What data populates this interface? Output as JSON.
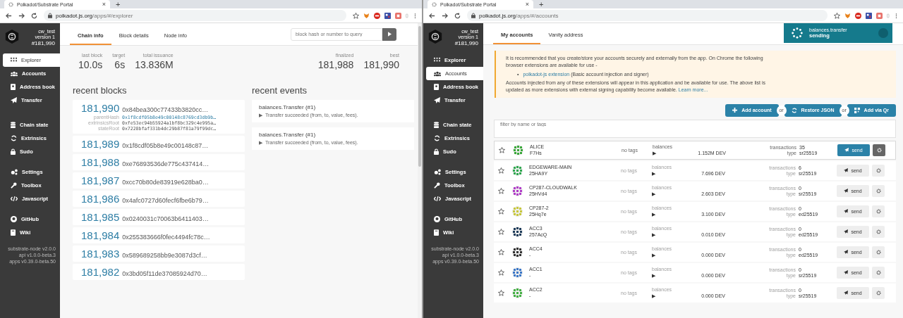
{
  "windows": [
    {
      "tab_title": "Polkadot/Substrate Portal",
      "tab_close": "×",
      "new_tab": "+",
      "url_host": "polkadot.js.org",
      "url_path": "/apps/#/explorer",
      "sidebar": {
        "chain": "cw_test",
        "version": "version 1",
        "block": "#181,990",
        "groups": [
          {
            "items": [
              {
                "label": "Explorer",
                "selected": true
              },
              {
                "label": "Accounts",
                "selected": false
              },
              {
                "label": "Address book",
                "selected": false
              },
              {
                "label": "Transfer",
                "selected": false
              }
            ]
          },
          {
            "items": [
              {
                "label": "Chain state",
                "selected": false
              },
              {
                "label": "Extrinsics",
                "selected": false
              },
              {
                "label": "Sudo",
                "selected": false
              }
            ]
          },
          {
            "items": [
              {
                "label": "Settings",
                "selected": false
              },
              {
                "label": "Toolbox",
                "selected": false
              },
              {
                "label": "Javascript",
                "selected": false
              }
            ]
          },
          {
            "items": [
              {
                "label": "GitHub",
                "selected": false
              },
              {
                "label": "Wiki",
                "selected": false
              }
            ]
          }
        ],
        "versions": [
          "substrate-node v2.0.0",
          "api v1.0.0-beta.3",
          "apps v0.39.0-beta.50"
        ]
      },
      "page": {
        "kind": "explorer",
        "tabs": [
          {
            "label": "Chain info",
            "selected": true
          },
          {
            "label": "Block details",
            "selected": false
          },
          {
            "label": "Node info",
            "selected": false
          }
        ],
        "search": {
          "placeholder": "block hash or number to query"
        },
        "summary_left": [
          {
            "label": "last block",
            "value": "10.0s"
          },
          {
            "label": "target",
            "value": "6s"
          },
          {
            "label": "total issuance",
            "value": "13.836M"
          }
        ],
        "summary_right": [
          {
            "label": "finalized",
            "value": "181,988"
          },
          {
            "label": "best",
            "value": "181,990"
          }
        ],
        "recent_blocks": {
          "title": "recent blocks",
          "blocks": [
            {
              "number": "181,990",
              "hash": "0x84bea300c77433b3820cc…",
              "details": [
                {
                  "label": "parentHash",
                  "value": "0x1f8cdf05b8e49c00148c8769cd3db9b…",
                  "kind": "link"
                },
                {
                  "label": "extrinsicsRoot",
                  "value": "0xfe53ec94b55924a1bf8bc329c4e995a…",
                  "kind": "hash"
                },
                {
                  "label": "stateRoot",
                  "value": "0x7228bfaf331b4dc29b87f81a79f99dc…",
                  "kind": "hash"
                }
              ]
            },
            {
              "number": "181,989",
              "hash": "0x1f8cdf05b8e49c00148c87…"
            },
            {
              "number": "181,988",
              "hash": "0xe76893536de775c437414…"
            },
            {
              "number": "181,987",
              "hash": "0xcc70b80de83919e628ba0…"
            },
            {
              "number": "181,986",
              "hash": "0x4afc0727d60fecf6fbe6b79…"
            },
            {
              "number": "181,985",
              "hash": "0x0240031c70063b6411403…"
            },
            {
              "number": "181,984",
              "hash": "0x255383666f0fec4494fc78c…"
            },
            {
              "number": "181,983",
              "hash": "0x589689258bb9e3087d3cf…"
            },
            {
              "number": "181,982",
              "hash": "0x3bd05f11de37085924d70…"
            }
          ]
        },
        "recent_events": {
          "title": "recent events",
          "events": [
            {
              "name": "balances.Transfer (#1)",
              "toggle": "▶",
              "description": "Transfer succeeded (from, to, value, fees)."
            },
            {
              "name": "balances.Transfer (#1)",
              "toggle": "▶",
              "description": "Transfer succeeded (from, to, value, fees)."
            }
          ]
        }
      }
    },
    {
      "tab_title": "Polkadot/Substrate Portal",
      "tab_close": "×",
      "new_tab": "+",
      "url_host": "polkadot.js.org",
      "url_path": "/apps/#/accounts",
      "sidebar": {
        "chain": "cw_test",
        "version": "version 1",
        "block": "#181,990",
        "groups": [
          {
            "items": [
              {
                "label": "Explorer",
                "selected": false
              },
              {
                "label": "Accounts",
                "selected": true
              },
              {
                "label": "Address book",
                "selected": false
              },
              {
                "label": "Transfer",
                "selected": false
              }
            ]
          },
          {
            "items": [
              {
                "label": "Chain state",
                "selected": false
              },
              {
                "label": "Extrinsics",
                "selected": false
              },
              {
                "label": "Sudo",
                "selected": false
              }
            ]
          },
          {
            "items": [
              {
                "label": "Settings",
                "selected": false
              },
              {
                "label": "Toolbox",
                "selected": false
              },
              {
                "label": "Javascript",
                "selected": false
              }
            ]
          },
          {
            "items": [
              {
                "label": "GitHub",
                "selected": false
              },
              {
                "label": "Wiki",
                "selected": false
              }
            ]
          }
        ],
        "versions": [
          "substrate-node v2.0.0",
          "api v1.0.0-beta.3",
          "apps v0.39.0-beta.50"
        ]
      },
      "page": {
        "kind": "accounts",
        "tabs": [
          {
            "label": "My accounts",
            "selected": true
          },
          {
            "label": "Vanity address",
            "selected": false
          }
        ],
        "status": {
          "action": "balances.transfer",
          "state": "sending"
        },
        "notice": {
          "intro": "It is recommended that you create/store your accounts securely and externally from the app. On Chrome the following browser extensions are available for use -",
          "extension": {
            "bullet": "•",
            "link": "polkadot-js extension",
            "text": " (Basic account injection and signer)"
          },
          "outro": "Accounts injected from any of these extensions will appear in this application and be available for use. The above list is updated as more extensions with external signing capability become available. ",
          "outro_link": "Learn more..."
        },
        "actions": [
          {
            "kind": "button",
            "label": "Add account"
          },
          {
            "kind": "separator",
            "label": "or"
          },
          {
            "kind": "button",
            "label": "Restore JSON"
          },
          {
            "kind": "separator",
            "label": "or"
          },
          {
            "kind": "button",
            "label": "Add via Qr"
          }
        ],
        "filter": {
          "placeholder": "filter by name or tags"
        },
        "accounts": [
          {
            "name": "ALICE",
            "address": "F7Hs",
            "color": "#3aa83a",
            "tags": "no tags",
            "balances_label": "balances",
            "toggle": "▶",
            "balance": "1.152M DEV",
            "transactions_label": "transactions",
            "transactions": "35",
            "type_label": "type",
            "type": "sr25519",
            "send": "send",
            "selected": true
          },
          {
            "name": "EDGEWARE-MAIN",
            "address": "25HA9Y",
            "color": "#2fa84f",
            "tags": "no tags",
            "balances_label": "balances",
            "toggle": "▶",
            "balance": "7.696 DEV",
            "transactions_label": "transactions",
            "transactions": "6",
            "type_label": "type",
            "type": "sr25519",
            "send": "send",
            "selected": false
          },
          {
            "name": "CP287-CLOUDWALK",
            "address": "25HVd4",
            "color": "#b03cc8",
            "tags": "no tags",
            "balances_label": "balances",
            "toggle": "▶",
            "balance": "2.603 DEV",
            "transactions_label": "transactions",
            "transactions": "0",
            "type_label": "type",
            "type": "sr25519",
            "send": "send",
            "selected": false
          },
          {
            "name": "CP287-2",
            "address": "25Hq7e",
            "color": "#c8c83c",
            "tags": "no tags",
            "balances_label": "balances",
            "toggle": "▶",
            "balance": "3.100 DEV",
            "transactions_label": "transactions",
            "transactions": "0",
            "type_label": "type",
            "type": "ed25519",
            "send": "send",
            "selected": false
          },
          {
            "name": "ACC3",
            "address": "257AcQ",
            "color": "#1e3c5a",
            "tags": "no tags",
            "balances_label": "balances",
            "toggle": "▶",
            "balance": "0.010 DEV",
            "transactions_label": "transactions",
            "transactions": "0",
            "type_label": "type",
            "type": "ed25519",
            "send": "send",
            "selected": false
          },
          {
            "name": "ACC4",
            "address": "-",
            "color": "#333333",
            "tags": "no tags",
            "balances_label": "balances",
            "toggle": "▶",
            "balance": "0.000 DEV",
            "transactions_label": "transactions",
            "transactions": "0",
            "type_label": "type",
            "type": "ed25519",
            "send": "send",
            "selected": false
          },
          {
            "name": "ACC1",
            "address": "-",
            "color": "#3c78c8",
            "tags": "no tags",
            "balances_label": "balances",
            "toggle": "▶",
            "balance": "0.000 DEV",
            "transactions_label": "transactions",
            "transactions": "0",
            "type_label": "type",
            "type": "sr25519",
            "send": "send",
            "selected": false
          },
          {
            "name": "ACC2",
            "address": "-",
            "color": "#44b044",
            "tags": "no tags",
            "balances_label": "balances",
            "toggle": "▶",
            "balance": "0.000 DEV",
            "transactions_label": "transactions",
            "transactions": "0",
            "type_label": "type",
            "type": "sr25519",
            "send": "send",
            "selected": false
          }
        ]
      }
    }
  ]
}
